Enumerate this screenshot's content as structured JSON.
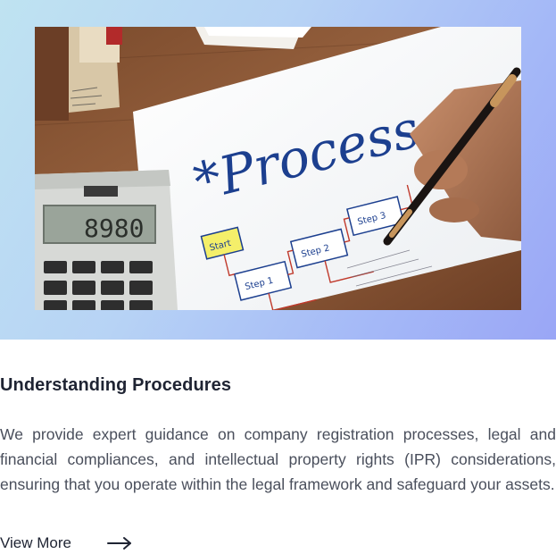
{
  "card": {
    "image_alt": "",
    "photo_text": {
      "heading": "*Process",
      "box_start": "Start",
      "box_step1": "Step 1",
      "box_step2": "Step 2",
      "box_step3": "Step 3",
      "calculator_display": "8980"
    },
    "title": "Understanding Procedures",
    "description": "We provide expert guidance on company registration processes, legal and financial compliances, and intellectual property rights (IPR) considerations, ensuring that you operate within the legal framework and safeguard your assets.",
    "link_label": "View More",
    "link_icon": "arrow-right-icon"
  },
  "colors": {
    "hero_gradient_start": "#bfe3f1",
    "hero_gradient_end": "#9aa6f6",
    "title": "#1f2433",
    "body_text": "#4a4f5c",
    "ink_blue": "#1c3f8f"
  }
}
